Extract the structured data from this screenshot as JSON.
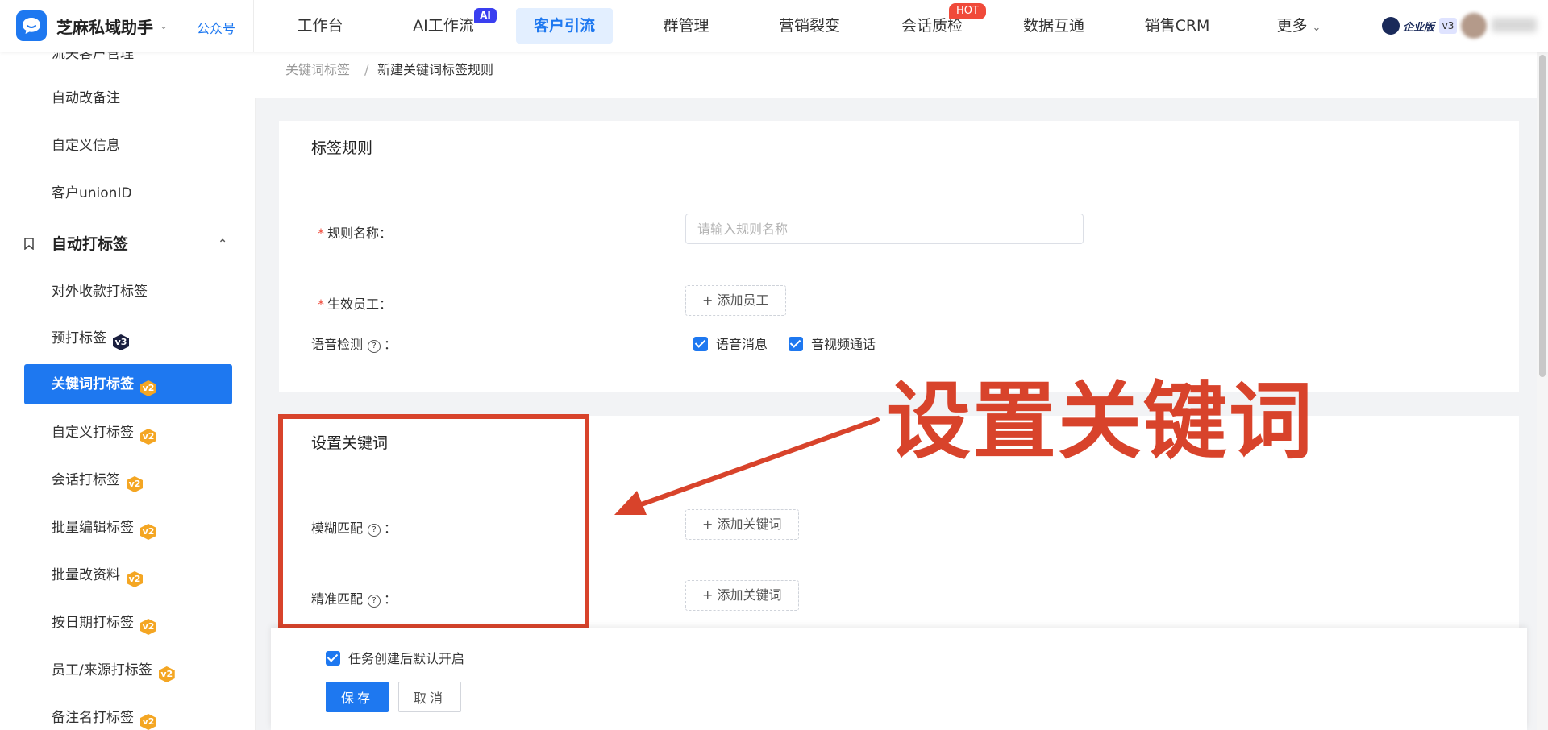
{
  "app": {
    "name": "芝麻私域助手",
    "account_type": "公众号",
    "edition": "企业版",
    "edition_version": "v3"
  },
  "nav": {
    "items": [
      "工作台",
      "AI工作流",
      "客户引流",
      "群管理",
      "营销裂变",
      "会话质检",
      "数据互通",
      "销售CRM",
      "更多"
    ],
    "active": "客户引流",
    "ai_badge": "AI",
    "hot_badge": "HOT"
  },
  "sidebar": {
    "partial_top": "流失客户管理",
    "items_before": [
      "自动改备注",
      "自定义信息",
      "客户unionID"
    ],
    "group_label": "自动打标签",
    "items": [
      {
        "label": "对外收款打标签",
        "badge": ""
      },
      {
        "label": "预打标签",
        "badge": "v3"
      },
      {
        "label": "关键词打标签",
        "badge": "v2"
      },
      {
        "label": "自定义打标签",
        "badge": "v2"
      },
      {
        "label": "会话打标签",
        "badge": "v2"
      },
      {
        "label": "批量编辑标签",
        "badge": "v2"
      },
      {
        "label": "批量改资料",
        "badge": "v2"
      },
      {
        "label": "按日期打标签",
        "badge": "v2"
      },
      {
        "label": "员工/来源打标签",
        "badge": "v2"
      },
      {
        "label": "备注名打标签",
        "badge": "v2"
      }
    ],
    "active_item": "关键词打标签"
  },
  "breadcrumb": {
    "parent": "关键词标签",
    "separator": "/",
    "current": "新建关键词标签规则"
  },
  "rule_card": {
    "title": "标签规则",
    "rule_name_label": "规则名称：",
    "rule_name_placeholder": "请输入规则名称",
    "rule_name_value": "",
    "staff_label": "生效员工：",
    "staff_button": "+ 添加员工",
    "voice_label": "语音检测",
    "voice_options": [
      {
        "label": "语音消息",
        "checked": true
      },
      {
        "label": "音视频通话",
        "checked": true
      }
    ]
  },
  "keyword_card": {
    "title": "设置关键词",
    "fuzzy_label": "模糊匹配",
    "fuzzy_button": "+ 添加关键词",
    "exact_label": "精准匹配",
    "exact_button": "+ 添加关键词"
  },
  "annotation": {
    "text": "设置关键词",
    "color": "#d8432b"
  },
  "footer": {
    "enable_label": "任务创建后默认开启",
    "enable_checked": true,
    "save": "保存",
    "cancel": "取消"
  },
  "colors": {
    "primary": "#1e78f0",
    "required": "#f04a3a",
    "badge_v2": "#f4a623",
    "badge_v3": "#1b2040"
  }
}
